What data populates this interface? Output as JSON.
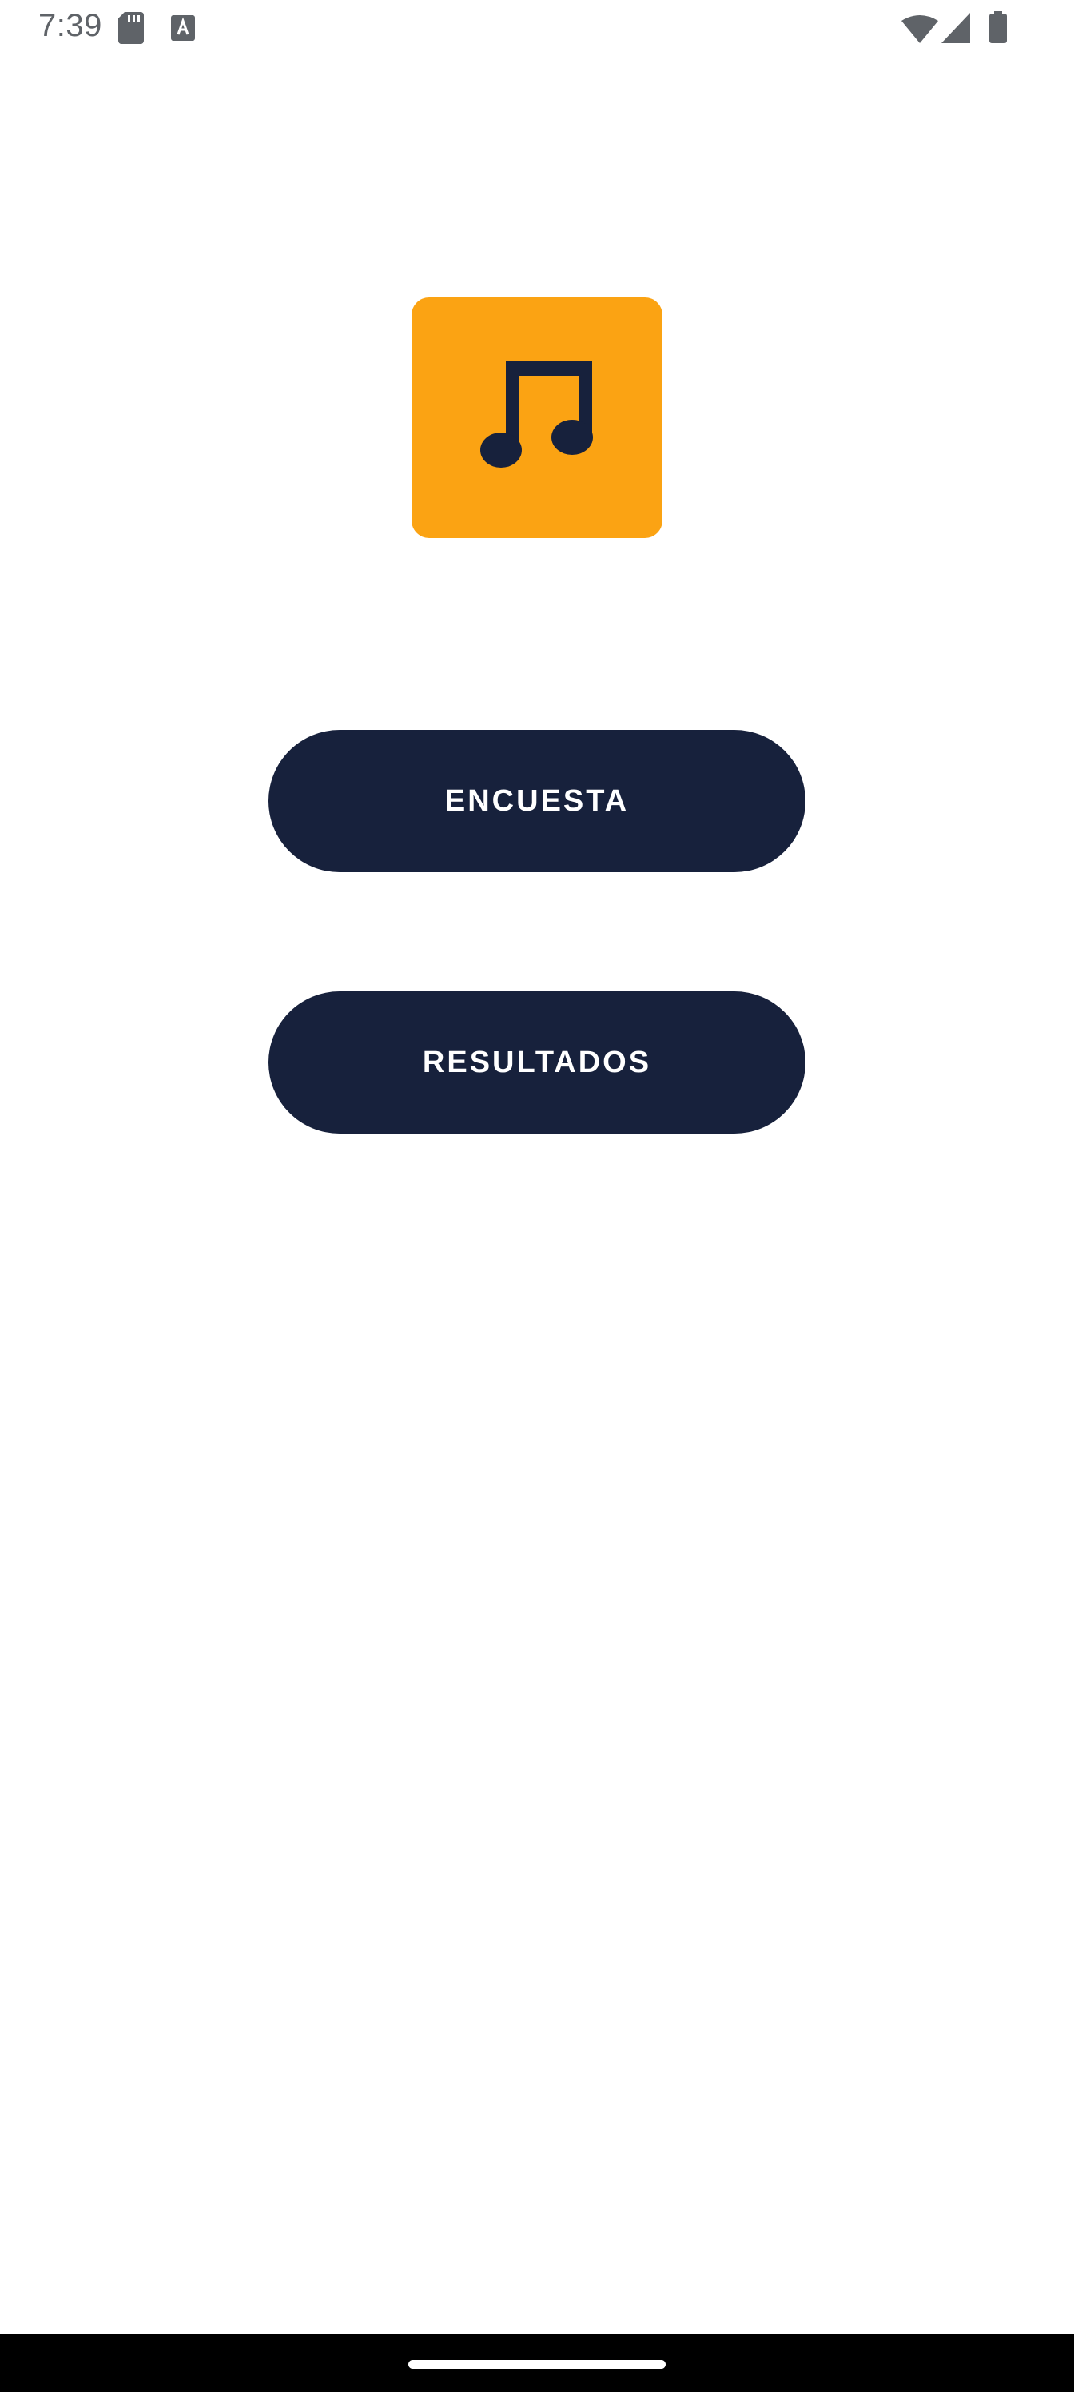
{
  "status_bar": {
    "time": "7:39",
    "icons": [
      "sd-card-icon",
      "keyboard-a-icon",
      "wifi-icon",
      "cellular-signal-icon",
      "battery-icon"
    ]
  },
  "logo": {
    "icon": "music-note-icon",
    "background_color": "#fba313",
    "icon_color": "#17213c"
  },
  "buttons": {
    "encuesta_label": "ENCUESTA",
    "resultados_label": "RESULTADOS",
    "color": "#17213c"
  },
  "nav_bar": {
    "handle": "home-gesture-handle"
  }
}
